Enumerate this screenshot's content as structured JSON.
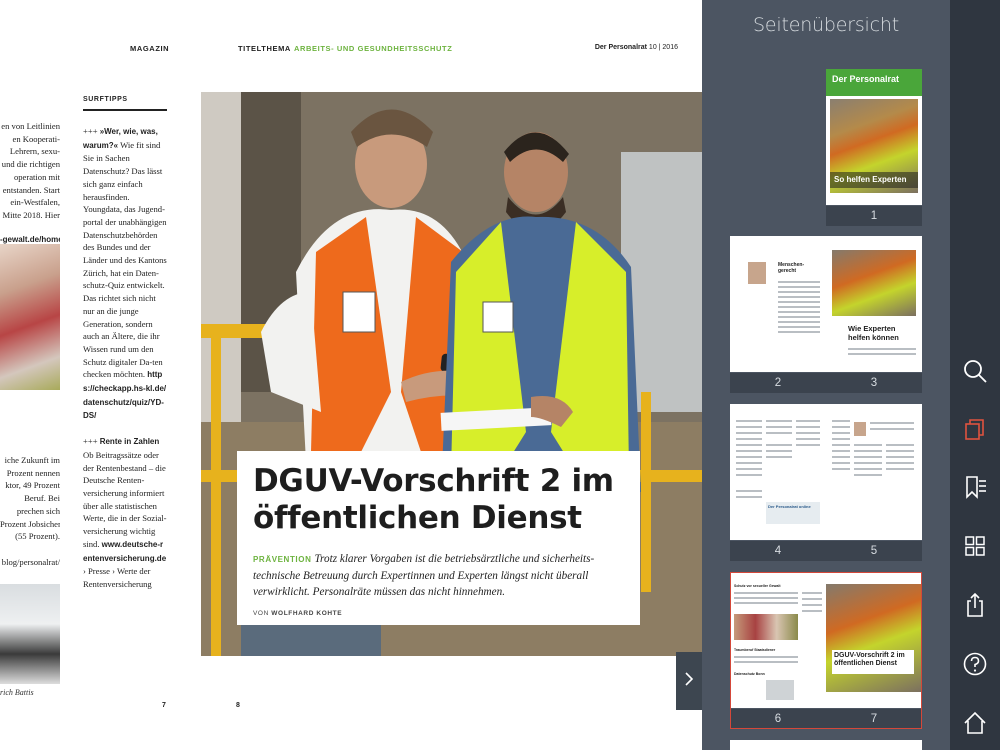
{
  "magazine": {
    "header_section_left": "MAGAZIN",
    "header_section_main": "TITELTHEMA",
    "header_topic": "ARBEITS- UND GESUNDHEITSSCHUTZ",
    "header_pub": "Der Personalrat",
    "header_issue": "10 | 2016",
    "left_column_lines": [
      {
        "text": "en von Leitlinien",
        "bold": false
      },
      {
        "text": "en Kooperati-",
        "bold": false
      },
      {
        "text": "Lehrern, sexu-",
        "bold": false
      },
      {
        "text": "und die richtigen",
        "bold": false
      },
      {
        "text": "operation mit",
        "bold": false
      },
      {
        "text": "entstanden. Start",
        "bold": false
      },
      {
        "text": "ein-Westfalen,",
        "bold": false
      },
      {
        "text": "Mitte 2018. Hier",
        "bold": false
      },
      {
        "text": "",
        "bold": false
      },
      {
        "text": "-gewalt.de/home",
        "bold": true
      }
    ],
    "left_column_lines_2": [
      {
        "text": "iche Zukunft im",
        "bold": false
      },
      {
        "text": "Prozent nennen",
        "bold": false
      },
      {
        "text": "ktor, 49 Prozent",
        "bold": false
      },
      {
        "text": "Beruf. Bei",
        "bold": false
      },
      {
        "text": "prechen sich",
        "bold": false
      },
      {
        "text": "Prozent Jobsicher-",
        "bold": false
      },
      {
        "text": "(55 Prozent).",
        "bold": false
      },
      {
        "text": "",
        "bold": false
      },
      {
        "text": "blog/personalrat/",
        "bold": true
      }
    ],
    "left_caption": "rich Battis",
    "surf_title": "SURFTIPPS",
    "surf_p1_prefix": "+++ ",
    "surf_p1_bold": "»Wer, wie, was, warum?«",
    "surf_p1_text": " Wie fit sind Sie in Sachen Datenschutz? Das lässt sich ganz einfach herausfinden. Youngdata, das Jugend-portal der unabhängigen Datenschutzbehörden des Bundes und der Länder und des Kantons Zürich, hat ein Daten-schutz-Quiz entwickelt. Das richtet sich nicht nur an die junge Generation, sondern auch an Ältere, die ihr Wissen rund um den Schutz digitaler Da-ten checken möchten.",
    "surf_p1_link": "https://checkapp.hs-kl.de/datenschutz/quiz/YD-DS/",
    "surf_p2_prefix": "+++ ",
    "surf_p2_bold": "Rente in Zahlen",
    "surf_p2_text": " Ob Beitragssätze oder der Rentenbestand – die Deutsche Renten-versicherung informiert über alle statistischen Werte, die in der Sozial-versicherung wichtig sind.",
    "surf_p2_link": "www.deutsche-rentenversicherung.de",
    "surf_p2_tail": " › Presse › Werte der Rentenversicherung",
    "title": "DGUV-Vorschrift 2 im öffentlichen Dienst",
    "lead_kicker": "PRÄVENTION",
    "lead": "Trotz klarer Vorgaben ist die betriebsärztliche und sicherheits-technische Betreuung durch Expertinnen und Experten längst nicht überall verwirklicht. Personalräte müssen das nicht hinnehmen.",
    "byline_prefix": "VON ",
    "byline_author": "WOLFHARD KOHTE",
    "page_left": "7",
    "page_right": "8"
  },
  "panel": {
    "title": "Seitenübersicht",
    "cover_title": "Der Personalrat",
    "cover_caption": "So helfen Experten",
    "spread23_heading_left": "Menschen-gerecht",
    "spread23_heading_right": "Wie Experten helfen können",
    "spread45_box": "Der Personalrat online",
    "spread67_title": "DGUV-Vorschrift 2 im öffentlichen Dienst",
    "spread67_left_head1": "Schutz vor sexueller Gewalt",
    "spread67_left_head2": "Traumberuf Staatsdiener",
    "spread67_left_head3": "Daten­schutz Bonn",
    "pages": {
      "p1": "1",
      "p2": "2",
      "p3": "3",
      "p4": "4",
      "p5": "5",
      "p6": "6",
      "p7": "7"
    },
    "selected_spread": "6-7",
    "selection_color": "#d4483a"
  },
  "toolbar": {
    "icons": [
      "search-icon",
      "pages-icon",
      "bookmarks-icon",
      "grid-icon",
      "share-icon",
      "help-icon",
      "home-icon"
    ],
    "active_color": "#e0533f"
  }
}
